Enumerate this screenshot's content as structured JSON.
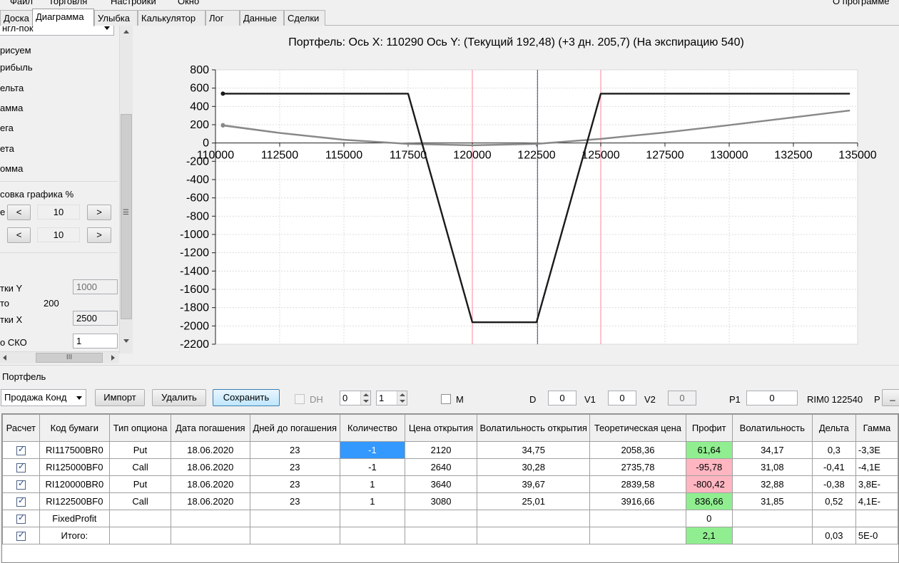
{
  "menu": [
    "Файл",
    "Торговля",
    "Настройки",
    "Окно",
    "О программе"
  ],
  "tabs": [
    "Доска",
    "Диаграмма",
    "Улыбка",
    "Калькулятор",
    "Лог",
    "Данные",
    "Сделки"
  ],
  "left_panel": {
    "combo_value": "нгл-пок",
    "draw_label": "рисуем",
    "checks": [
      "рибыль",
      "ельта",
      "амма",
      "ега",
      "ета",
      "омма"
    ],
    "shift_label": "совка графика %",
    "row1_label": "е",
    "shift1": "10",
    "shift2": "10",
    "prev": "<",
    "next": ">",
    "step_y_label": "тки Y",
    "step_y_value": "1000",
    "to_label": "то",
    "to_value": "200",
    "step_x_label": "тки X",
    "step_x_value": "2500",
    "sko_label": "о СКО",
    "sko_value": "1",
    "hscroll_grip": "III",
    "vscroll_grip": "☰"
  },
  "chart": {
    "title": "Портфель: Ось X: 110290 Ось Y:  (Текущий 192,48)  (+3 дн. 205,7)  (На экспирацию 540)"
  },
  "chart_data": {
    "type": "line",
    "xlim": [
      110000,
      135000
    ],
    "ylim": [
      -2200,
      800
    ],
    "x_ticks": [
      110000,
      112500,
      115000,
      117500,
      120000,
      122500,
      125000,
      127500,
      130000,
      132500,
      135000
    ],
    "y_ticks": [
      800,
      600,
      400,
      200,
      0,
      -200,
      -400,
      -600,
      -800,
      -1000,
      -1200,
      -1400,
      -1600,
      -1800,
      -2000,
      -2200
    ],
    "vertical_lines": [
      {
        "x": 120000,
        "color": "#ff9aa8"
      },
      {
        "x": 122540,
        "color": "#5a6a8a"
      },
      {
        "x": 125000,
        "color": "#ff9aa8"
      }
    ],
    "series": [
      {
        "values_x": [
          110290,
          117500,
          120000,
          122500,
          125000,
          134700
        ],
        "values_y": [
          540,
          540,
          -1960,
          -1960,
          540,
          540
        ],
        "color": "#1a1a1a",
        "width": 2.4
      },
      {
        "values_x": [
          110290,
          112500,
          115000,
          117500,
          120000,
          122500,
          125000,
          127500,
          130000,
          132500,
          134700
        ],
        "values_y": [
          192,
          110,
          35,
          -10,
          -25,
          -10,
          45,
          115,
          195,
          280,
          355
        ],
        "color": "#888888",
        "width": 2.4
      },
      {
        "values_x": [
          110290,
          112500,
          115000,
          117500,
          120000,
          122500,
          125000,
          127500,
          130000,
          132500,
          134700
        ],
        "values_y": [
          200,
          115,
          40,
          -5,
          -20,
          -5,
          50,
          118,
          198,
          283,
          358
        ],
        "color": "#cfcfcf",
        "width": 1.4
      }
    ]
  },
  "portfolio": {
    "label": "Портфель",
    "combo_value": "Продажа Конд",
    "import": "Импорт",
    "delete": "Удалить",
    "save": "Сохранить",
    "dh": "DH",
    "spin1": "0",
    "spin2": "1",
    "m": "M",
    "d_label": "D",
    "d_value": "0",
    "v1_label": "V1",
    "v1_value": "0",
    "v2_label": "V2",
    "v2_value": "0",
    "p1_label": "P1",
    "p1_value": "0",
    "rim": "RIM0 122540",
    "p_label": "P",
    "p_btn": "_"
  },
  "table": {
    "headers": [
      "Расчет",
      "Код бумаги",
      "Тип опциона",
      "Дата погашения",
      "Дней до погашения",
      "Количество",
      "Цена открытия",
      "Волатильность открытия",
      "Теоретическая цена",
      "Профит",
      "Волатильность",
      "Дельта",
      "Гамма"
    ],
    "rows": [
      {
        "code": "RI117500BR0",
        "type": "Put",
        "date": "18.06.2020",
        "days": "23",
        "qty": "-1",
        "price": "2120",
        "vol_open": "34,75",
        "theor": "2058,36",
        "profit": "61,64",
        "profit_state": "pos",
        "vol": "34,17",
        "delta": "0,3",
        "gamma": "-3,3E",
        "selected": true
      },
      {
        "code": "RI125000BF0",
        "type": "Call",
        "date": "18.06.2020",
        "days": "23",
        "qty": "-1",
        "price": "2640",
        "vol_open": "30,28",
        "theor": "2735,78",
        "profit": "-95,78",
        "profit_state": "neg",
        "vol": "31,08",
        "delta": "-0,41",
        "gamma": "-4,1E"
      },
      {
        "code": "RI120000BR0",
        "type": "Put",
        "date": "18.06.2020",
        "days": "23",
        "qty": "1",
        "price": "3640",
        "vol_open": "39,67",
        "theor": "2839,58",
        "profit": "-800,42",
        "profit_state": "neg",
        "vol": "32,88",
        "delta": "-0,38",
        "gamma": "3,8E-"
      },
      {
        "code": "RI122500BF0",
        "type": "Call",
        "date": "18.06.2020",
        "days": "23",
        "qty": "1",
        "price": "3080",
        "vol_open": "25,01",
        "theor": "3916,66",
        "profit": "836,66",
        "profit_state": "pos",
        "vol": "31,85",
        "delta": "0,52",
        "gamma": "4,1E-"
      },
      {
        "code": "FixedProfit",
        "type": "",
        "date": "",
        "days": "",
        "qty": "",
        "price": "",
        "vol_open": "",
        "theor": "",
        "profit": "0",
        "profit_state": "",
        "vol": "",
        "delta": "",
        "gamma": ""
      },
      {
        "code": "Итого:",
        "type": "",
        "date": "",
        "days": "",
        "qty": "",
        "price": "",
        "vol_open": "",
        "theor": "",
        "profit": "2,1",
        "profit_state": "pos",
        "vol": "",
        "delta": "0,03",
        "gamma": "5E-0"
      }
    ]
  }
}
